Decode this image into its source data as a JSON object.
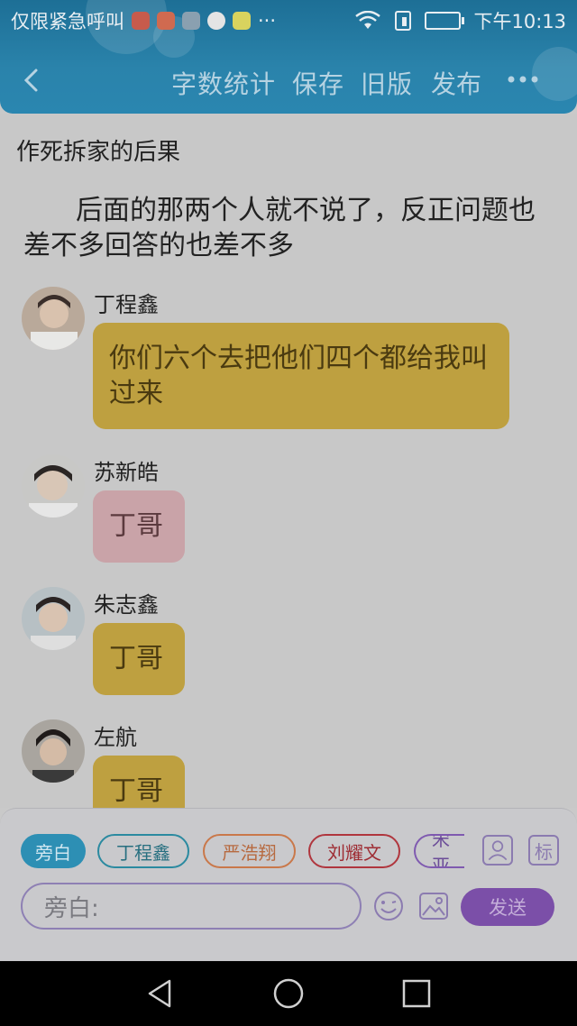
{
  "status_bar": {
    "left_text": "仅限紧急呼叫",
    "more": "···",
    "time": "下午10:13"
  },
  "toolbar": {
    "word_count": "字数统计",
    "save": "保存",
    "old_version": "旧版",
    "publish": "发布"
  },
  "story": {
    "title": "作死拆家的后果",
    "paragraph": "后面的那两个人就不说了，反正问题也差不多回答的也差不多"
  },
  "messages": [
    {
      "speaker": "丁程鑫",
      "text": "你们六个去把他们四个都给我叫过来",
      "color": "#bea040"
    },
    {
      "speaker": "苏新皓",
      "text": "丁哥",
      "color": "#c9a3a8"
    },
    {
      "speaker": "朱志鑫",
      "text": "丁哥",
      "color": "#bea040"
    },
    {
      "speaker": "左航",
      "text": "丁哥",
      "color": "#bea040"
    }
  ],
  "composer": {
    "roles": [
      "旁白",
      "丁程鑫",
      "严浩翔",
      "刘耀文",
      "宋亚"
    ],
    "side_label": "标",
    "input_placeholder": "旁白:",
    "send": "发送"
  },
  "colors": {
    "header": "#2a83ab",
    "gold_bubble": "#bea040",
    "pink_bubble": "#c9a3a8",
    "send_button": "#7b4fa8"
  }
}
